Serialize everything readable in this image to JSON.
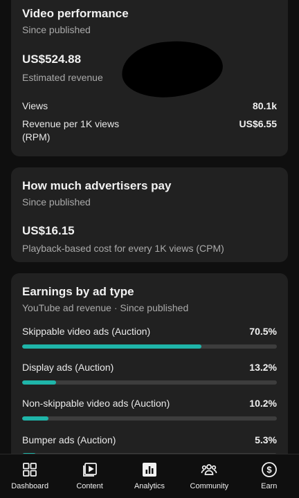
{
  "video_performance": {
    "title": "Video performance",
    "subtitle": "Since published",
    "revenue_value": "US$524.88",
    "revenue_label": "Estimated revenue",
    "metrics": [
      {
        "label": "Views",
        "value": "80.1k"
      },
      {
        "label": "Revenue per 1K views (RPM)",
        "value": "US$6.55"
      }
    ]
  },
  "advertisers": {
    "title": "How much advertisers pay",
    "subtitle": "Since published",
    "cpm_value": "US$16.15",
    "cpm_label": "Playback-based cost for every 1K views (CPM)"
  },
  "earnings": {
    "title": "Earnings by ad type",
    "subtitle": "YouTube ad revenue · Since published",
    "accent_color": "#1fb5a9",
    "items": [
      {
        "label": "Skippable video ads (Auction)",
        "percent": "70.5%",
        "share": 70.5
      },
      {
        "label": "Display ads (Auction)",
        "percent": "13.2%",
        "share": 13.2
      },
      {
        "label": "Non-skippable video ads (Auction)",
        "percent": "10.2%",
        "share": 10.2
      },
      {
        "label": "Bumper ads (Auction)",
        "percent": "5.3%",
        "share": 5.3
      }
    ]
  },
  "nav": {
    "items": [
      {
        "label": "Dashboard",
        "icon": "dashboard-icon"
      },
      {
        "label": "Content",
        "icon": "content-icon"
      },
      {
        "label": "Analytics",
        "icon": "analytics-icon"
      },
      {
        "label": "Community",
        "icon": "community-icon"
      },
      {
        "label": "Earn",
        "icon": "earn-icon"
      }
    ]
  }
}
